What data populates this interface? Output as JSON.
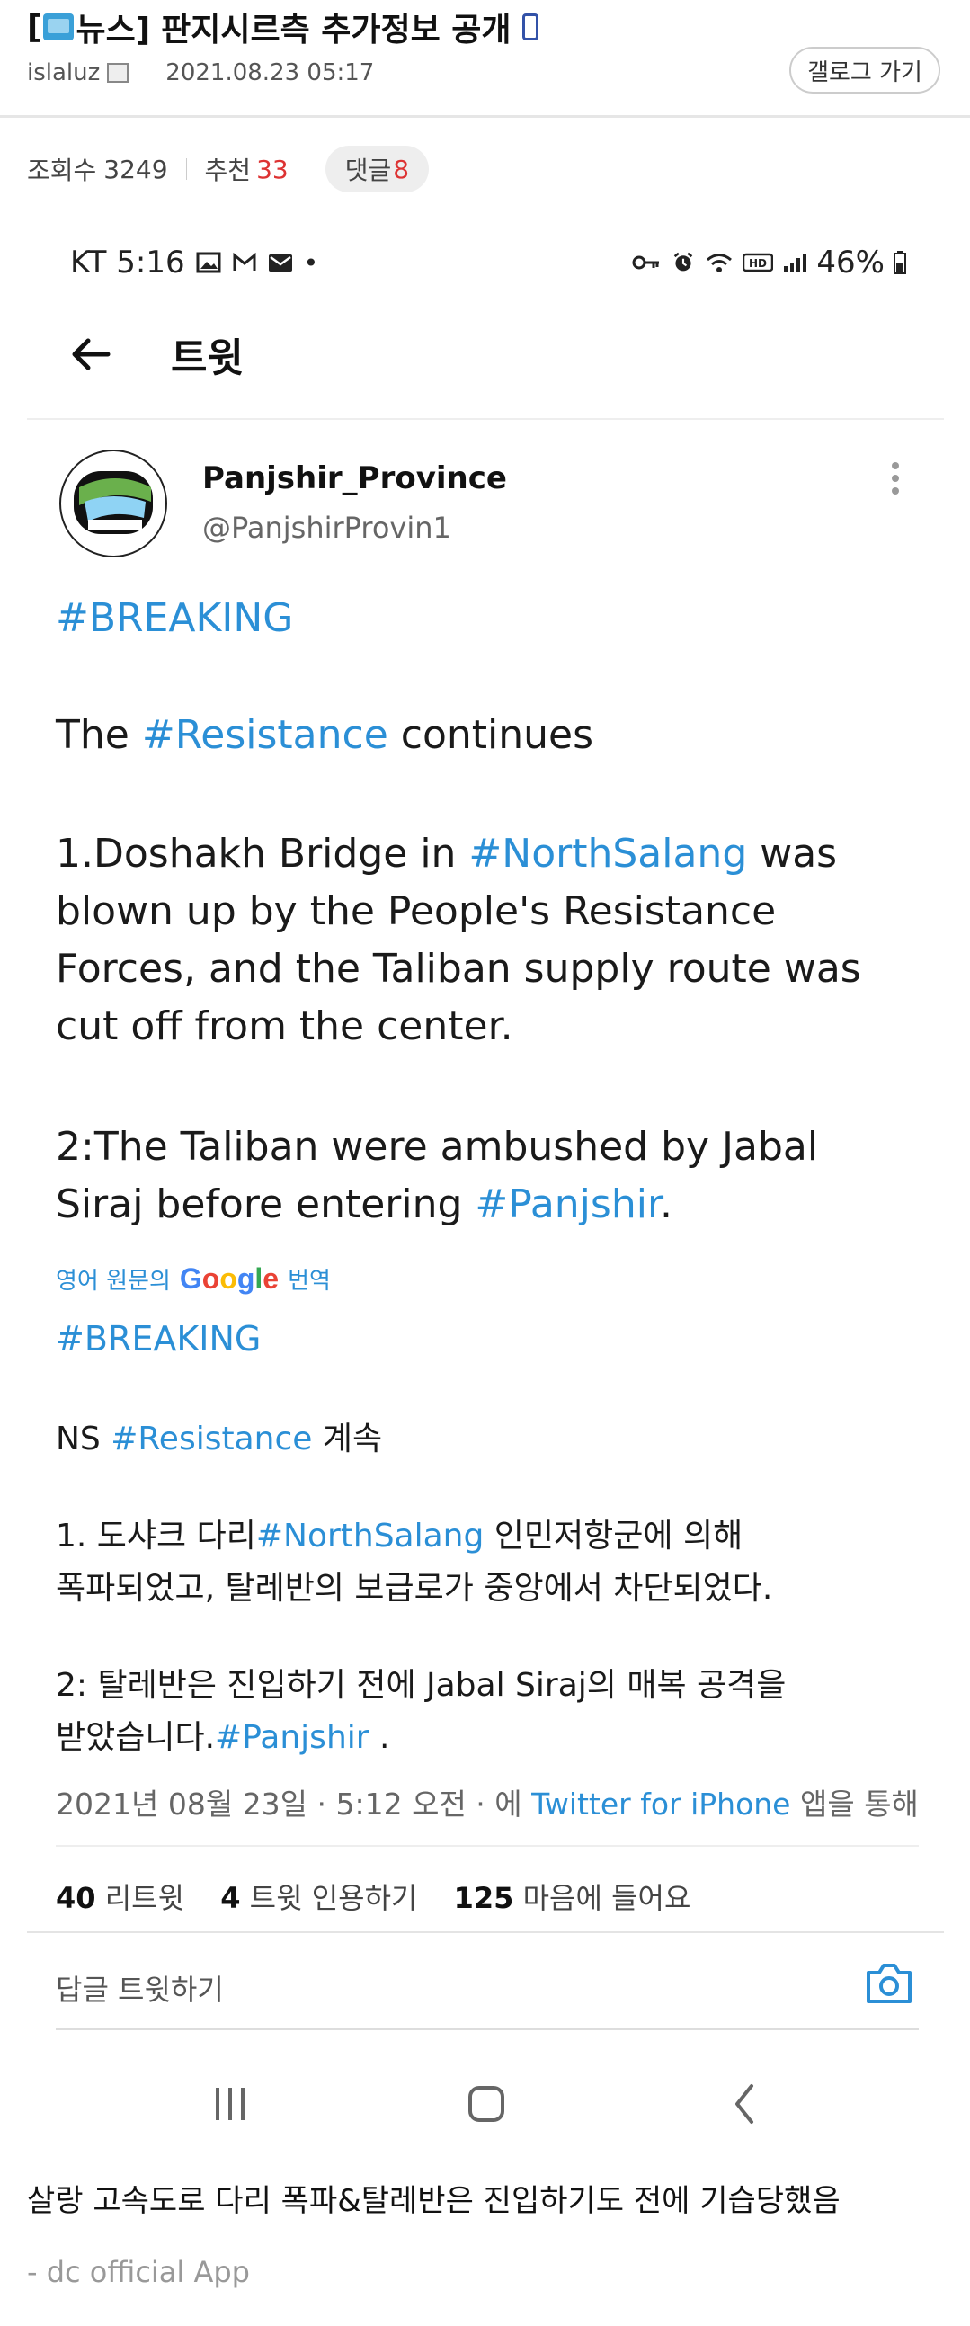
{
  "post": {
    "title_prefix": "[",
    "title_category": "뉴스]",
    "title_text": "판지시르측 추가정보 공개",
    "author": "islaluz",
    "datetime": "2021.08.23 05:17",
    "gallery_button": "갤로그 가기",
    "views_label": "조회수",
    "views": "3249",
    "recommend_label": "추천",
    "recommend": "33",
    "comments_label": "댓글",
    "comments": "8"
  },
  "phone": {
    "carrier_time": "KT 5:16",
    "battery": "46%",
    "header_title": "트윗"
  },
  "tweet": {
    "display_name": "Panjshir_Province",
    "handle": "@PanjshirProvin1",
    "line_breaking": "#BREAKING",
    "line2_a": "The ",
    "line2_link": "#Resistance",
    "line2_b": " continues",
    "p1_a": "1.Doshakh Bridge in ",
    "p1_link": "#NorthSalang",
    "p1_b": " was",
    "p1_l2": "blown up by the People's Resistance",
    "p1_l3": "Forces, and the Taliban supply route was",
    "p1_l4": "cut off from the center.",
    "p2_l1": "2:The Taliban were ambushed by Jabal",
    "p2_a": "Siraj before entering ",
    "p2_link": "#Panjshir",
    "p2_b": ".",
    "translate_prefix": "영어 원문의",
    "translate_suffix": "번역",
    "kr_breaking": "#BREAKING",
    "kr_l2_a": "NS ",
    "kr_l2_link": "#Resistance",
    "kr_l2_b": " 계속",
    "kr_p1_a": " 1. 도샤크 다리",
    "kr_p1_link": "#NorthSalang",
    "kr_p1_b": " 인민저항군에 의해",
    "kr_p1_l2": "폭파되었고, 탈레반의 보급로가 중앙에서 차단되었다.",
    "kr_p2_l1": " 2: 탈레반은 진입하기 전에 Jabal Siraj의 매복 공격을",
    "kr_p2_a": "받았습니다.",
    "kr_p2_link": "#Panjshir",
    "kr_p2_b": " .",
    "ts_a": "2021년 08월 23일 · 5:12 오전 · 에 ",
    "ts_link": "Twitter for iPhone",
    "ts_b": " 앱을 통해",
    "retweets": "40",
    "retweets_label": " 리트윗",
    "quotes": "4",
    "quotes_label": " 트윗 인용하기",
    "likes": "125",
    "likes_label": " 마음에 들어요",
    "reply_placeholder": "답글 트윗하기"
  },
  "caption": "살랑 고속도로 다리 폭파&탈레반은 진입하기도 전에 기습당했음",
  "footer": "- dc official App",
  "colors": {
    "link": "#2b8fd6",
    "accent_red": "#d33333"
  }
}
